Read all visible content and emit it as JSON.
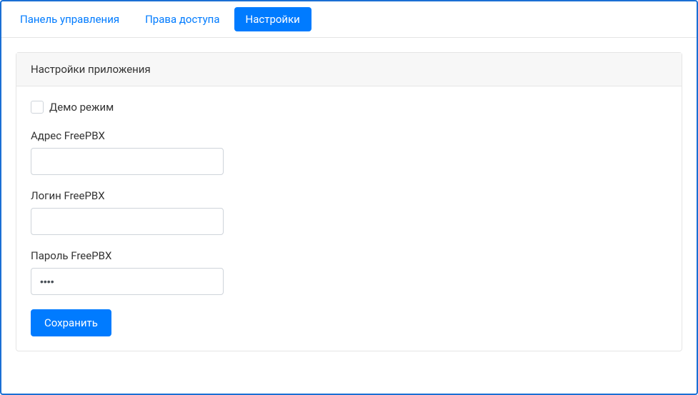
{
  "tabs": {
    "dashboard": "Панель управления",
    "access": "Права доступа",
    "settings": "Настройки"
  },
  "panel": {
    "title": "Настройки приложения"
  },
  "form": {
    "demo_mode_label": "Демо режим",
    "demo_mode_checked": false,
    "address_label": "Адрес FreePBX",
    "address_value": "",
    "login_label": "Логин FreePBX",
    "login_value": "",
    "password_label": "Пароль FreePBX",
    "password_value": "••••",
    "save_label": "Сохранить"
  }
}
